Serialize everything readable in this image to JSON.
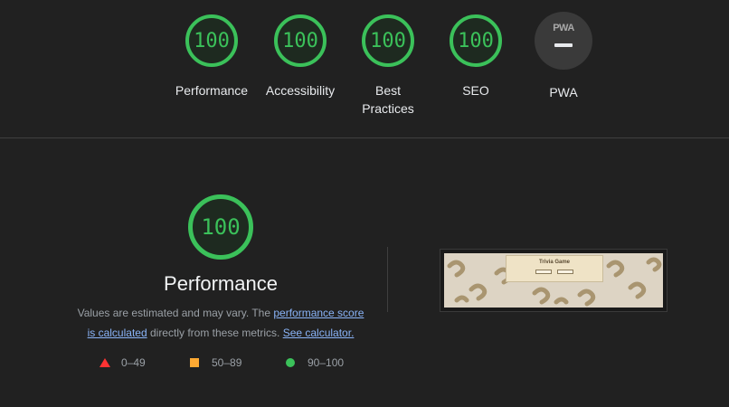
{
  "summary_gauges": [
    {
      "score": "100",
      "label": "Performance"
    },
    {
      "score": "100",
      "label": "Accessibility"
    },
    {
      "score": "100",
      "label": "Best Practices"
    },
    {
      "score": "100",
      "label": "SEO"
    }
  ],
  "pwa": {
    "logo": "PWA",
    "dash": "—",
    "label": "PWA"
  },
  "performance": {
    "score": "100",
    "title": "Performance",
    "desc_pre": "Values are estimated and may vary. The ",
    "desc_link1": "performance score is calculated",
    "desc_mid": " directly from these metrics. ",
    "desc_link2": "See calculator.",
    "score_color": "#3bc15a"
  },
  "legend": [
    {
      "range": "0–49",
      "shape": "triangle",
      "color": "#ff3333"
    },
    {
      "range": "50–89",
      "shape": "square",
      "color": "#ffaa33"
    },
    {
      "range": "90–100",
      "shape": "circle",
      "color": "#3bc15a"
    }
  ],
  "screenshot": {
    "title": "Trivia Game"
  }
}
